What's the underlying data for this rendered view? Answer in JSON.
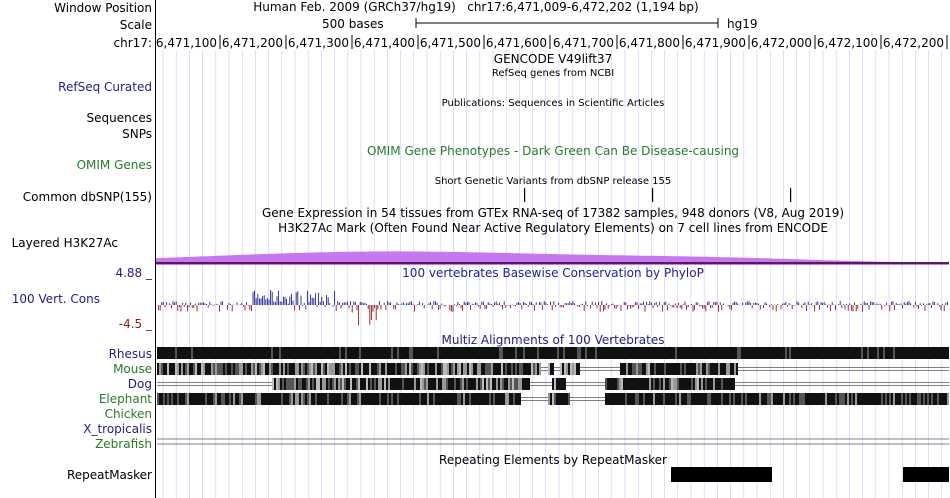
{
  "header": {
    "position_label": "Window Position",
    "scale_label": "Scale",
    "chrom_label": "chr17:",
    "assembly_title": "Human Feb. 2009 (GRCh37/hg19)   chr17:6,471,009-6,472,202 (1,194 bp)",
    "scale_text": "500 bases",
    "db_text": "hg19",
    "ruler_ticks": [
      "6,471,100",
      "6,471,200",
      "6,471,300",
      "6,471,400",
      "6,471,500",
      "6,471,600",
      "6,471,700",
      "6,471,800",
      "6,471,900",
      "6,472,000",
      "6,472,100",
      "6,472,200"
    ]
  },
  "tracks": {
    "gencode_title": "GENCODE V49lift37",
    "refseq_desc": "RefSeq genes from NCBI",
    "refseq_label": "RefSeq Curated",
    "publications_desc": "Publications: Sequences in Scientific Articles",
    "sequences_label": "Sequences",
    "snps_label": "SNPs",
    "omim_desc": "OMIM Gene Phenotypes - Dark Green Can Be Disease-causing",
    "omim_label": "OMIM Genes",
    "dbsnp_desc": "Short Genetic Variants from dbSNP release 155",
    "dbsnp_label": "Common dbSNP(155)",
    "gtex_desc": "Gene Expression in 54 tissues from GTEx RNA-seq of 17382 samples, 948 donors (V8, Aug 2019)",
    "h3k27_desc": "H3K27Ac Mark (Often Found Near Active Regulatory Elements) on 7 cell lines from ENCODE",
    "h3k27_label": "Layered H3K27Ac",
    "cons_max": "4.88 _",
    "cons_desc": "100 vertebrates Basewise Conservation by PhyloP",
    "cons_label": "100 Vert. Cons",
    "cons_min": "-4.5 _",
    "multiz_desc": "Multiz Alignments of 100 Vertebrates",
    "species": [
      "Rhesus",
      "Mouse",
      "Dog",
      "Elephant",
      "Chicken",
      "X_tropicalis",
      "Zebrafish"
    ],
    "repeat_desc": "Repeating Elements by RepeatMasker",
    "repeat_label": "RepeatMasker"
  },
  "colors": {
    "navy": "#1f1f7a",
    "green": "#2a7a2a",
    "h3k27": "#c678f0",
    "cons_pos": "#1f1f8f",
    "cons_neg": "#8b1a1a",
    "grid": "#c8c8f0"
  }
}
